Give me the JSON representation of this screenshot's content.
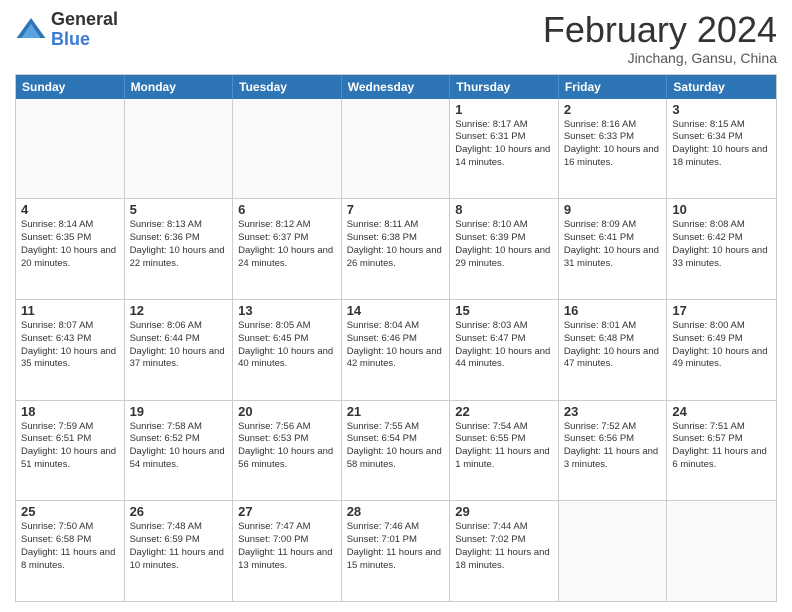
{
  "logo": {
    "general": "General",
    "blue": "Blue"
  },
  "title": "February 2024",
  "location": "Jinchang, Gansu, China",
  "days_of_week": [
    "Sunday",
    "Monday",
    "Tuesday",
    "Wednesday",
    "Thursday",
    "Friday",
    "Saturday"
  ],
  "weeks": [
    [
      {
        "day": "",
        "info": "",
        "empty": true
      },
      {
        "day": "",
        "info": "",
        "empty": true
      },
      {
        "day": "",
        "info": "",
        "empty": true
      },
      {
        "day": "",
        "info": "",
        "empty": true
      },
      {
        "day": "1",
        "info": "Sunrise: 8:17 AM\nSunset: 6:31 PM\nDaylight: 10 hours and 14 minutes.",
        "empty": false
      },
      {
        "day": "2",
        "info": "Sunrise: 8:16 AM\nSunset: 6:33 PM\nDaylight: 10 hours and 16 minutes.",
        "empty": false
      },
      {
        "day": "3",
        "info": "Sunrise: 8:15 AM\nSunset: 6:34 PM\nDaylight: 10 hours and 18 minutes.",
        "empty": false
      }
    ],
    [
      {
        "day": "4",
        "info": "Sunrise: 8:14 AM\nSunset: 6:35 PM\nDaylight: 10 hours and 20 minutes.",
        "empty": false
      },
      {
        "day": "5",
        "info": "Sunrise: 8:13 AM\nSunset: 6:36 PM\nDaylight: 10 hours and 22 minutes.",
        "empty": false
      },
      {
        "day": "6",
        "info": "Sunrise: 8:12 AM\nSunset: 6:37 PM\nDaylight: 10 hours and 24 minutes.",
        "empty": false
      },
      {
        "day": "7",
        "info": "Sunrise: 8:11 AM\nSunset: 6:38 PM\nDaylight: 10 hours and 26 minutes.",
        "empty": false
      },
      {
        "day": "8",
        "info": "Sunrise: 8:10 AM\nSunset: 6:39 PM\nDaylight: 10 hours and 29 minutes.",
        "empty": false
      },
      {
        "day": "9",
        "info": "Sunrise: 8:09 AM\nSunset: 6:41 PM\nDaylight: 10 hours and 31 minutes.",
        "empty": false
      },
      {
        "day": "10",
        "info": "Sunrise: 8:08 AM\nSunset: 6:42 PM\nDaylight: 10 hours and 33 minutes.",
        "empty": false
      }
    ],
    [
      {
        "day": "11",
        "info": "Sunrise: 8:07 AM\nSunset: 6:43 PM\nDaylight: 10 hours and 35 minutes.",
        "empty": false
      },
      {
        "day": "12",
        "info": "Sunrise: 8:06 AM\nSunset: 6:44 PM\nDaylight: 10 hours and 37 minutes.",
        "empty": false
      },
      {
        "day": "13",
        "info": "Sunrise: 8:05 AM\nSunset: 6:45 PM\nDaylight: 10 hours and 40 minutes.",
        "empty": false
      },
      {
        "day": "14",
        "info": "Sunrise: 8:04 AM\nSunset: 6:46 PM\nDaylight: 10 hours and 42 minutes.",
        "empty": false
      },
      {
        "day": "15",
        "info": "Sunrise: 8:03 AM\nSunset: 6:47 PM\nDaylight: 10 hours and 44 minutes.",
        "empty": false
      },
      {
        "day": "16",
        "info": "Sunrise: 8:01 AM\nSunset: 6:48 PM\nDaylight: 10 hours and 47 minutes.",
        "empty": false
      },
      {
        "day": "17",
        "info": "Sunrise: 8:00 AM\nSunset: 6:49 PM\nDaylight: 10 hours and 49 minutes.",
        "empty": false
      }
    ],
    [
      {
        "day": "18",
        "info": "Sunrise: 7:59 AM\nSunset: 6:51 PM\nDaylight: 10 hours and 51 minutes.",
        "empty": false
      },
      {
        "day": "19",
        "info": "Sunrise: 7:58 AM\nSunset: 6:52 PM\nDaylight: 10 hours and 54 minutes.",
        "empty": false
      },
      {
        "day": "20",
        "info": "Sunrise: 7:56 AM\nSunset: 6:53 PM\nDaylight: 10 hours and 56 minutes.",
        "empty": false
      },
      {
        "day": "21",
        "info": "Sunrise: 7:55 AM\nSunset: 6:54 PM\nDaylight: 10 hours and 58 minutes.",
        "empty": false
      },
      {
        "day": "22",
        "info": "Sunrise: 7:54 AM\nSunset: 6:55 PM\nDaylight: 11 hours and 1 minute.",
        "empty": false
      },
      {
        "day": "23",
        "info": "Sunrise: 7:52 AM\nSunset: 6:56 PM\nDaylight: 11 hours and 3 minutes.",
        "empty": false
      },
      {
        "day": "24",
        "info": "Sunrise: 7:51 AM\nSunset: 6:57 PM\nDaylight: 11 hours and 6 minutes.",
        "empty": false
      }
    ],
    [
      {
        "day": "25",
        "info": "Sunrise: 7:50 AM\nSunset: 6:58 PM\nDaylight: 11 hours and 8 minutes.",
        "empty": false
      },
      {
        "day": "26",
        "info": "Sunrise: 7:48 AM\nSunset: 6:59 PM\nDaylight: 11 hours and 10 minutes.",
        "empty": false
      },
      {
        "day": "27",
        "info": "Sunrise: 7:47 AM\nSunset: 7:00 PM\nDaylight: 11 hours and 13 minutes.",
        "empty": false
      },
      {
        "day": "28",
        "info": "Sunrise: 7:46 AM\nSunset: 7:01 PM\nDaylight: 11 hours and 15 minutes.",
        "empty": false
      },
      {
        "day": "29",
        "info": "Sunrise: 7:44 AM\nSunset: 7:02 PM\nDaylight: 11 hours and 18 minutes.",
        "empty": false
      },
      {
        "day": "",
        "info": "",
        "empty": true
      },
      {
        "day": "",
        "info": "",
        "empty": true
      }
    ]
  ]
}
